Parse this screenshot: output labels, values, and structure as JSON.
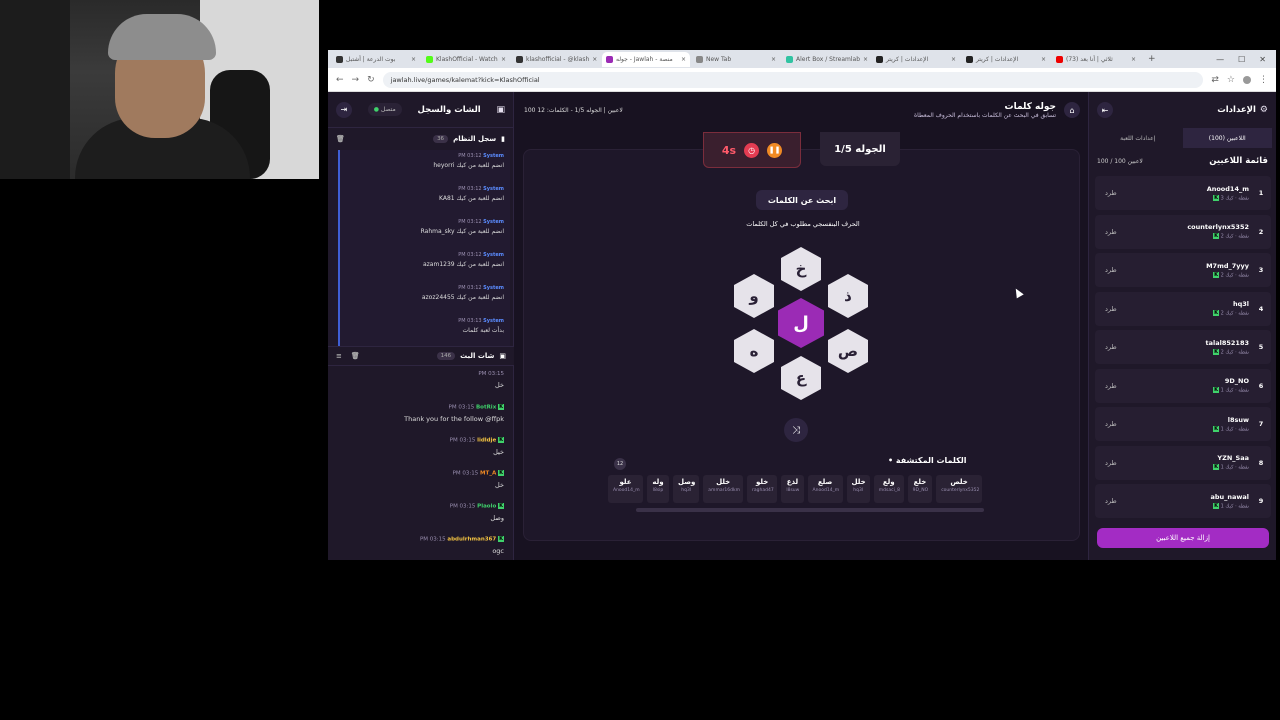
{
  "browser": {
    "tabs": [
      {
        "label": "بوت الدرعة | أشتبل"
      },
      {
        "label": "KlashOfficial - Watch"
      },
      {
        "label": "klashofficial - @klash"
      },
      {
        "label": "جوله - Jawlah - منصة"
      },
      {
        "label": "New Tab"
      },
      {
        "label": "Alert Box / Streamlab"
      },
      {
        "label": "الإعدادات | كريتر"
      },
      {
        "label": "الإعدادات | كريتر"
      },
      {
        "label": "(73) ثلاثي | أنا بعد"
      }
    ],
    "url": "jawlah.live/games/kalemat?kick=KlashOfficial"
  },
  "chat": {
    "title": "الشات والسجل",
    "status": "متصل",
    "system_log_title": "سجل النظام",
    "system_log_count": "36",
    "system_items": [
      {
        "who": "System",
        "time": "PM 03:12",
        "msg": "heyorri انضم للعبة من كيك"
      },
      {
        "who": "System",
        "time": "PM 03:12",
        "msg": "KA81 انضم للعبة من كيك"
      },
      {
        "who": "System",
        "time": "PM 03:12",
        "msg": "Rahma_sky انضم للعبة من كيك"
      },
      {
        "who": "System",
        "time": "PM 03:12",
        "msg": "azam1239 انضم للعبة من كيك"
      },
      {
        "who": "System",
        "time": "PM 03:12",
        "msg": "azoz24455 انضم للعبة من كيك"
      },
      {
        "who": "System",
        "time": "PM 03:13",
        "msg": "بدأت لعبة كلمات"
      }
    ],
    "bot_title": "شات البث",
    "bot_count": "146",
    "bot_items": [
      {
        "who": "",
        "time": "PM 03:15",
        "msg": "خل",
        "color": "#e04060"
      },
      {
        "who": "BotRix",
        "time": "PM 03:15",
        "msg": "Thank you for the follow @ffpk",
        "color": "#3fd26b"
      },
      {
        "who": "lidldje",
        "time": "PM 03:15",
        "msg": "خيل",
        "color": "#f5c542"
      },
      {
        "who": "MT_A",
        "time": "PM 03:15",
        "msg": "خل",
        "color": "#f08a24"
      },
      {
        "who": "Plaolo",
        "time": "PM 03:15",
        "msg": "وصل",
        "color": "#3fd26b"
      },
      {
        "who": "abdulrhman367",
        "time": "PM 03:15",
        "msg": "ogc",
        "color": "#f5c542"
      }
    ]
  },
  "game": {
    "title": "جوله كلمات",
    "subtitle": "تسابق في البحث عن الكلمات باستخدام الحروف المعطاة",
    "stats": "100 لاعبين | الجوله 1/5 - الكلمات: 12",
    "timer": "4s",
    "round": "الجوله 1/5",
    "search_label": "ابحث عن الكلمات",
    "hint": "الحرف البنفسجي مطلوب في كل الكلمات",
    "letters": {
      "center": "ل",
      "top": "خ",
      "top_left": "و",
      "top_right": "ذ",
      "bottom_left": "ه",
      "bottom_right": "ص",
      "bottom": "ع"
    },
    "found_title": "• الكلمات المكتشفة",
    "found_count": "12",
    "words": [
      {
        "w": "خلص",
        "u": "counterlynx5352"
      },
      {
        "w": "خلع",
        "u": "9D_NO"
      },
      {
        "w": "ولع",
        "u": "mdsaci_8"
      },
      {
        "w": "خلل",
        "u": "hq3l"
      },
      {
        "w": "صلع",
        "u": "Anood14_m"
      },
      {
        "w": "لذع",
        "u": "l8suw"
      },
      {
        "w": "خلو",
        "u": "raghad47"
      },
      {
        "w": "خلل",
        "u": "ammar16dkm"
      },
      {
        "w": "وصل",
        "u": "hq3l"
      },
      {
        "w": "وله",
        "u": "l8sip"
      },
      {
        "w": "علو",
        "u": "Anood14_m"
      }
    ]
  },
  "settings": {
    "title": "الإعدادات",
    "tab_players": "اللاعبين (100)",
    "tab_game": "إعدادات اللعبة",
    "players_title": "قائمة اللاعبين",
    "players_count": "100 / 100 لاعبين",
    "kick_label": "طرد",
    "players": [
      {
        "rank": "1",
        "name": "Anood14_m",
        "pts": "3 نقطة · كيك"
      },
      {
        "rank": "2",
        "name": "counterlynx5352",
        "pts": "2 نقطة · كيك"
      },
      {
        "rank": "3",
        "name": "M7md_7yyy",
        "pts": "2 نقطة · كيك"
      },
      {
        "rank": "4",
        "name": "hq3l",
        "pts": "2 نقطة · كيك"
      },
      {
        "rank": "5",
        "name": "talal852183",
        "pts": "2 نقطة · كيك"
      },
      {
        "rank": "6",
        "name": "9D_NO",
        "pts": "1 نقطة · كيك"
      },
      {
        "rank": "7",
        "name": "l8suw",
        "pts": "1 نقطة · كيك"
      },
      {
        "rank": "8",
        "name": "YZN_Saa",
        "pts": "1 نقطة · كيك"
      },
      {
        "rank": "9",
        "name": "abu_nawal",
        "pts": "1 نقطة · كيك"
      }
    ],
    "remove_all": "إزالة جميع اللاعبين"
  }
}
